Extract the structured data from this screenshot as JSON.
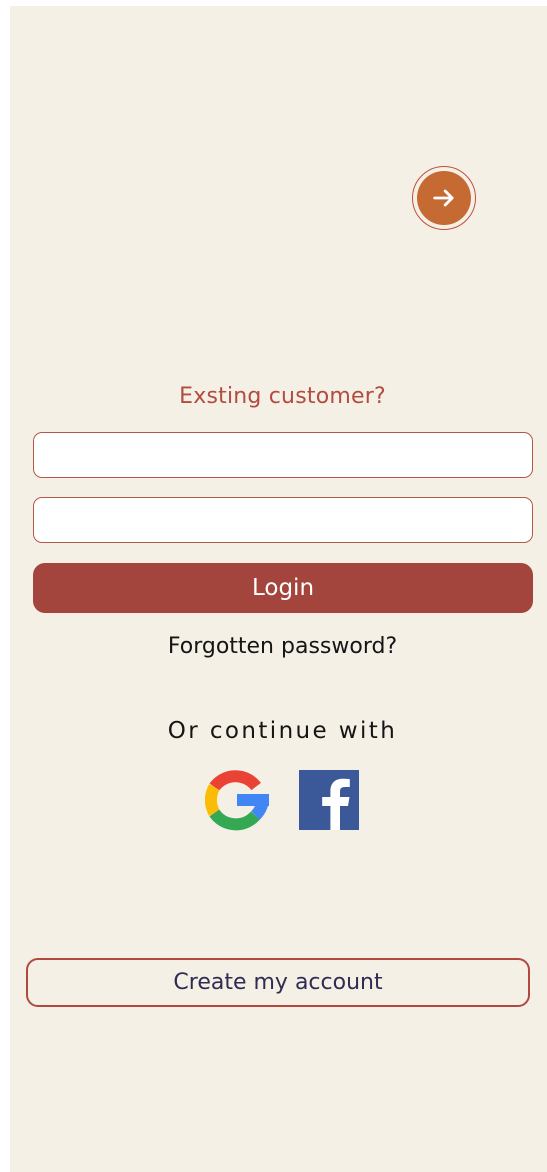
{
  "colors": {
    "background": "#f5f0e6",
    "accent": "#a3453c",
    "skip_button": "#c66a34",
    "heading": "#b24c3f",
    "create_text": "#2e2c52"
  },
  "skip": {
    "icon": "arrow-right-icon"
  },
  "login": {
    "heading": "Exsting customer?",
    "username_value": "",
    "password_value": "",
    "submit_label": "Login",
    "forgot_label": "Forgotten password?"
  },
  "social": {
    "label": "Or continue with",
    "providers": [
      {
        "icon": "google-icon"
      },
      {
        "icon": "facebook-icon"
      }
    ]
  },
  "signup": {
    "label": "Create my account"
  }
}
